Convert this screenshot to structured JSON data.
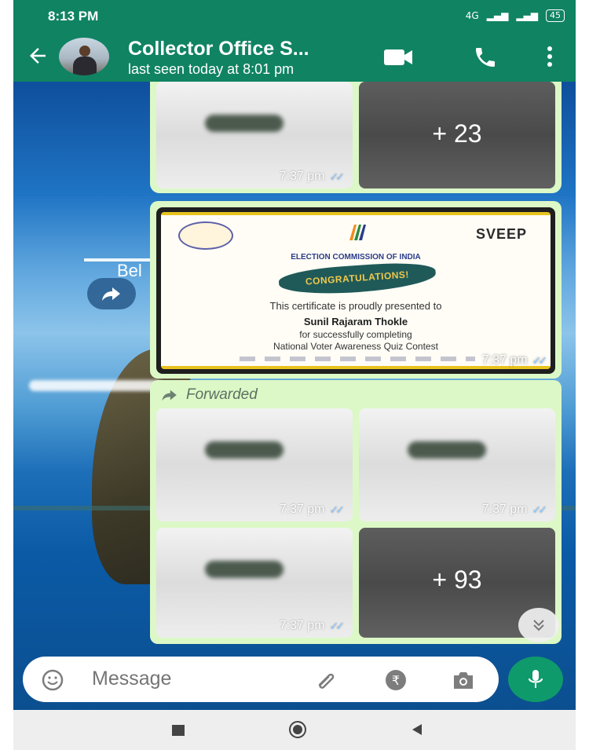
{
  "status_bar": {
    "time": "8:13 PM",
    "network": "4G",
    "battery": "45"
  },
  "header": {
    "title": "Collector Office S...",
    "subtitle": "last seen today at 8:01 pm"
  },
  "background": {
    "partial_text": "Bel"
  },
  "messages": [
    {
      "type": "album",
      "thumbnails": [
        {
          "tone": "light",
          "time": "7:37 pm"
        },
        {
          "tone": "dark",
          "overlay_count": "+ 23"
        }
      ]
    },
    {
      "type": "image",
      "certificate": {
        "brand": "SVEEP",
        "heading": "ELECTION COMMISSION OF INDIA",
        "banner": "CONGRATULATIONS!",
        "line1": "This certificate is proudly presented to",
        "name": "Sunil Rajaram Thokle",
        "line3": "for successfully completing",
        "line4": "National Voter Awareness Quiz Contest"
      },
      "time": "7:37 pm"
    },
    {
      "type": "album",
      "forwarded_label": "Forwarded",
      "thumbnails": [
        {
          "tone": "light",
          "time": "7:37 pm"
        },
        {
          "tone": "light",
          "time": "7:37 pm"
        },
        {
          "tone": "light",
          "time": "7:37 pm"
        },
        {
          "tone": "dark",
          "overlay_count": "+ 93"
        }
      ]
    }
  ],
  "input_bar": {
    "placeholder": "Message"
  },
  "colors": {
    "header_green": "#108362",
    "bubble_green": "#dcf8c6",
    "mic_green": "#0f9a6b",
    "read_tick_blue": "#8ec9ff"
  },
  "icons": [
    "back-arrow-icon",
    "video-call-icon",
    "phone-icon",
    "more-vert-icon",
    "forward-icon",
    "emoji-icon",
    "attach-icon",
    "rupee-icon",
    "camera-icon",
    "mic-icon",
    "double-chevron-down-icon",
    "read-ticks-icon"
  ]
}
